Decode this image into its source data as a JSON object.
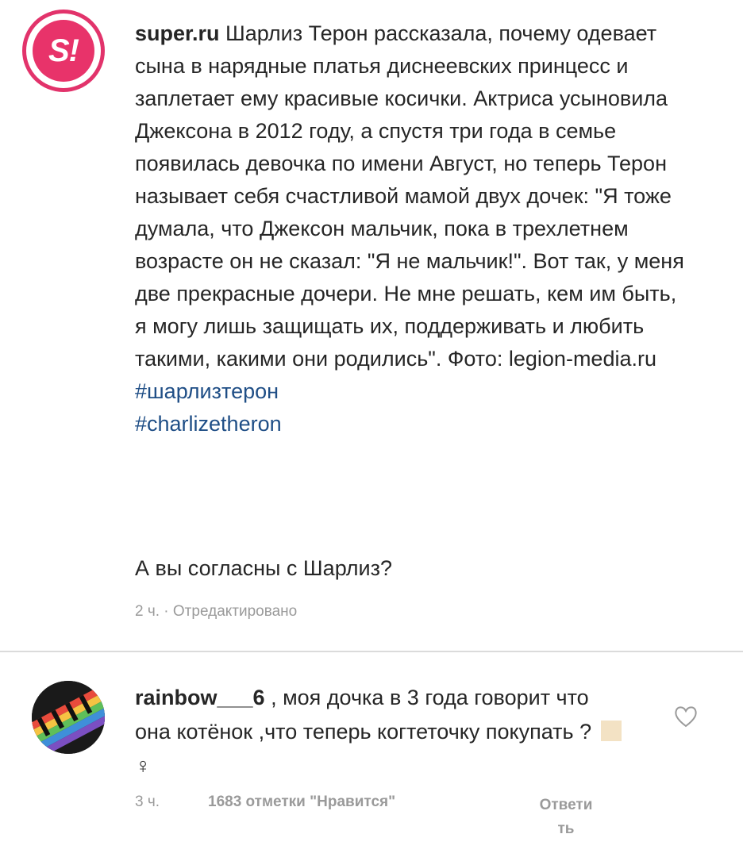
{
  "post": {
    "avatar_text": "S!",
    "username": "super.ru",
    "caption": " Шарлиз Терон рассказала, почему одевает сына в нарядные платья диснеевских принцесс и заплетает ему красивые косички. Актриса усыновила Джексона в 2012 году, а спустя три года в семье появилась девочка по имени Август, но теперь Терон называет себя счастливой мамой двух дочек: \"Я тоже думала, что Джексон мальчик, пока в трехлетнем возрасте он не сказал: \"Я не мальчик!\". Вот так, у меня две прекрасные дочери. Не мне решать, кем им быть, я могу лишь защищать их, поддерживать и любить такими, какими они родились\". Фото: legion-media.ru ",
    "hashtags": [
      "#шарлизтерон",
      "#charlizetheron"
    ],
    "question": "А вы согласны с Шарлиз?",
    "meta": "2 ч. · Отредактировано"
  },
  "comment": {
    "username": "rainbow___6",
    "text_before_emoji": " , моя дочка в 3 года говорит что она котёнок ,что теперь когтеточку покупать ? ",
    "text_after_emoji": "♀",
    "time": "3 ч.",
    "likes": "1683 отметки \"Нравится\"",
    "reply": "Ответи ть",
    "heart_icon": "heart-outline-icon"
  },
  "colors": {
    "text": "#262626",
    "meta": "#9a9a9a",
    "hashtag": "#1f4e86",
    "brand": "#e8336a",
    "divider": "#dbdbdb"
  }
}
